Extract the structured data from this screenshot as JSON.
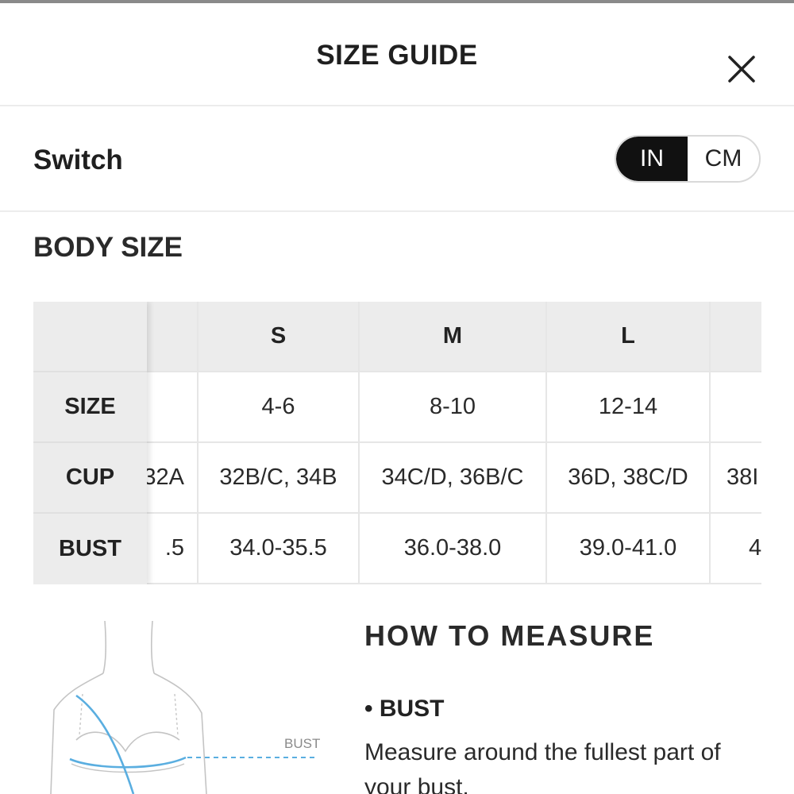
{
  "header": {
    "title": "SIZE GUIDE"
  },
  "switch": {
    "label": "Switch",
    "options": [
      "IN",
      "CM"
    ],
    "selected": "IN"
  },
  "body_size": {
    "title": "BODY SIZE",
    "row_labels": [
      "SIZE",
      "CUP",
      "BUST"
    ],
    "columns": [
      {
        "header": "",
        "size": "",
        "cup": "32A",
        "bust": ".5"
      },
      {
        "header": "S",
        "size": "4-6",
        "cup": "32B/C, 34B",
        "bust": "34.0-35.5"
      },
      {
        "header": "M",
        "size": "8-10",
        "cup": "34C/D, 36B/C",
        "bust": "36.0-38.0"
      },
      {
        "header": "L",
        "size": "12-14",
        "cup": "36D, 38C/D",
        "bust": "39.0-41.0"
      },
      {
        "header": "",
        "size": "",
        "cup": "38I",
        "bust": "4"
      }
    ]
  },
  "illustration": {
    "bust_label": "BUST"
  },
  "how_to_measure": {
    "title": "HOW TO MEASURE",
    "bust_heading": "• BUST",
    "bust_text": "Measure around the fullest part of your bust."
  },
  "colors": {
    "accent": "#111111",
    "header_cell_bg": "#ececec",
    "measure_line": "#5aaee0"
  }
}
